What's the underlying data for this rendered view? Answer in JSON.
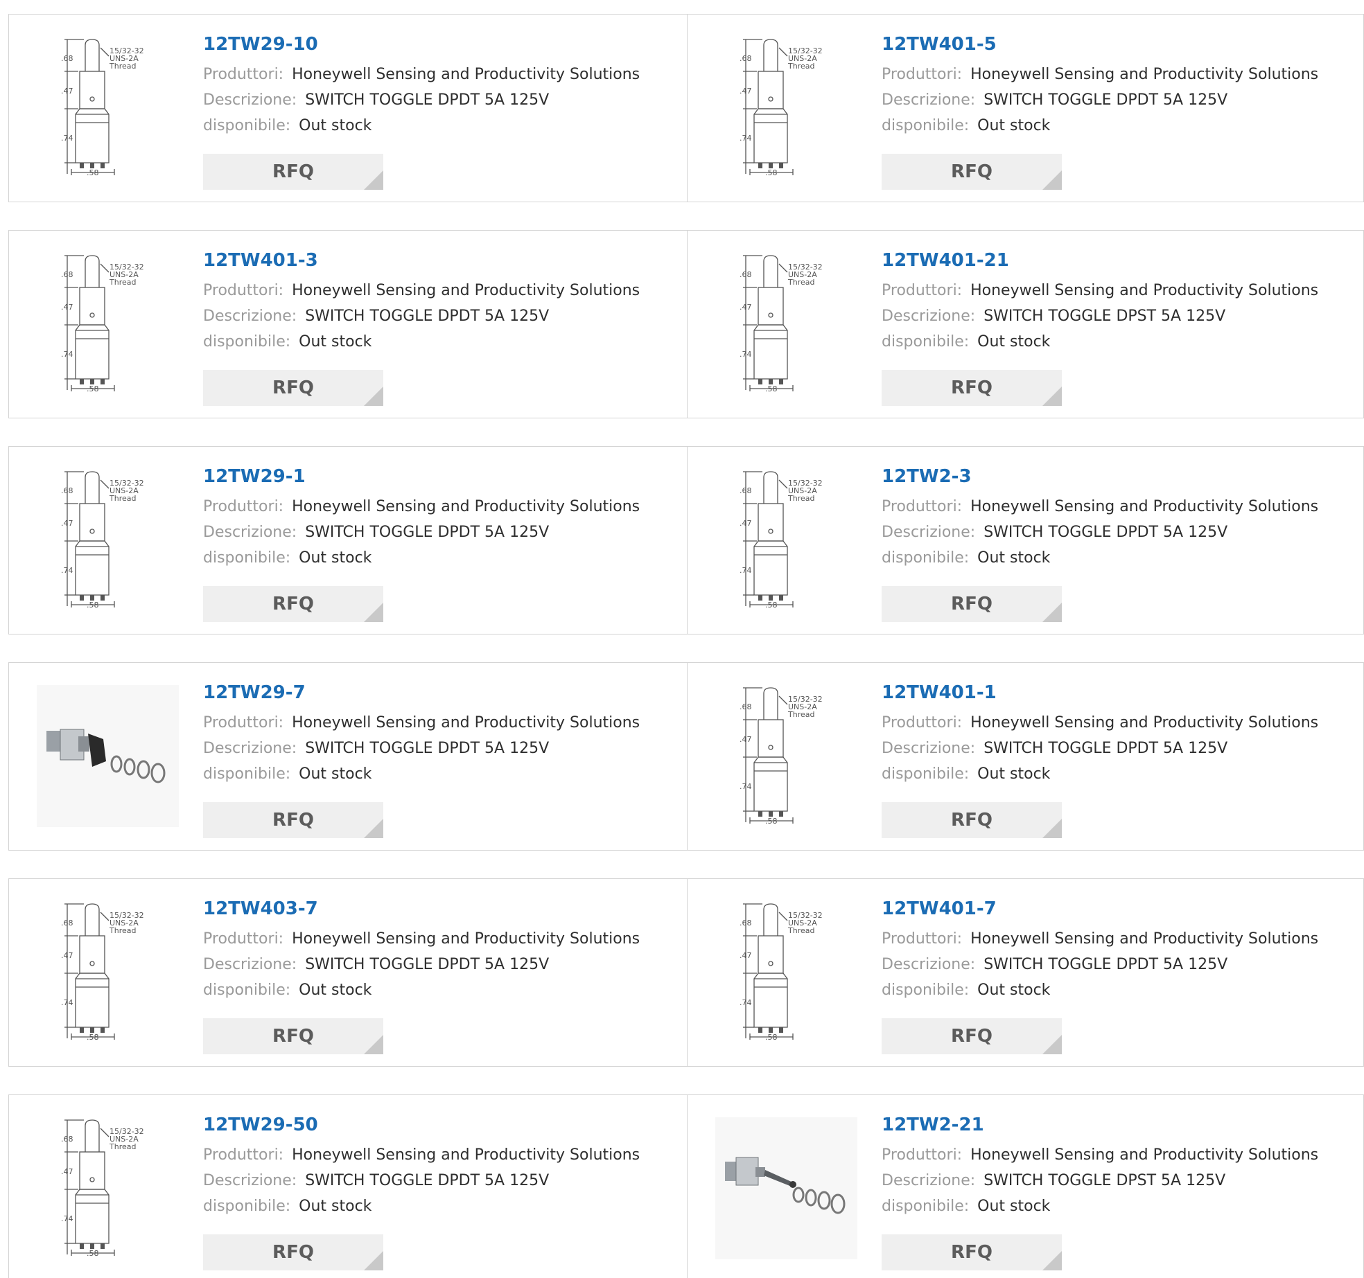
{
  "labels": {
    "manufacturer": "Produttori:",
    "description": "Descrizione:",
    "availability": "disponibile:",
    "rfq": "RFQ"
  },
  "drawing_text": {
    "d1": ".68",
    "d2": ".47",
    "d3": ".74",
    "width": ".58",
    "thread1": "15/32-32",
    "thread2": "UNS-2A",
    "thread3": "Thread"
  },
  "products": [
    {
      "part": "12TW29-10",
      "manufacturer": "Honeywell Sensing and Productivity Solutions",
      "description": "SWITCH TOGGLE DPDT 5A 125V",
      "availability": "Out stock",
      "image": "dimension-drawing"
    },
    {
      "part": "12TW401-5",
      "manufacturer": "Honeywell Sensing and Productivity Solutions",
      "description": "SWITCH TOGGLE DPDT 5A 125V",
      "availability": "Out stock",
      "image": "dimension-drawing"
    },
    {
      "part": "12TW401-3",
      "manufacturer": "Honeywell Sensing and Productivity Solutions",
      "description": "SWITCH TOGGLE DPDT 5A 125V",
      "availability": "Out stock",
      "image": "dimension-drawing"
    },
    {
      "part": "12TW401-21",
      "manufacturer": "Honeywell Sensing and Productivity Solutions",
      "description": "SWITCH TOGGLE DPST 5A 125V",
      "availability": "Out stock",
      "image": "dimension-drawing"
    },
    {
      "part": "12TW29-1",
      "manufacturer": "Honeywell Sensing and Productivity Solutions",
      "description": "SWITCH TOGGLE DPDT 5A 125V",
      "availability": "Out stock",
      "image": "dimension-drawing"
    },
    {
      "part": "12TW2-3",
      "manufacturer": "Honeywell Sensing and Productivity Solutions",
      "description": "SWITCH TOGGLE DPDT 5A 125V",
      "availability": "Out stock",
      "image": "dimension-drawing"
    },
    {
      "part": "12TW29-7",
      "manufacturer": "Honeywell Sensing and Productivity Solutions",
      "description": "SWITCH TOGGLE DPDT 5A 125V",
      "availability": "Out stock",
      "image": "product-photo-paddle"
    },
    {
      "part": "12TW401-1",
      "manufacturer": "Honeywell Sensing and Productivity Solutions",
      "description": "SWITCH TOGGLE DPDT 5A 125V",
      "availability": "Out stock",
      "image": "dimension-drawing"
    },
    {
      "part": "12TW403-7",
      "manufacturer": "Honeywell Sensing and Productivity Solutions",
      "description": "SWITCH TOGGLE DPDT 5A 125V",
      "availability": "Out stock",
      "image": "dimension-drawing"
    },
    {
      "part": "12TW401-7",
      "manufacturer": "Honeywell Sensing and Productivity Solutions",
      "description": "SWITCH TOGGLE DPDT 5A 125V",
      "availability": "Out stock",
      "image": "dimension-drawing"
    },
    {
      "part": "12TW29-50",
      "manufacturer": "Honeywell Sensing and Productivity Solutions",
      "description": "SWITCH TOGGLE DPDT 5A 125V",
      "availability": "Out stock",
      "image": "dimension-drawing"
    },
    {
      "part": "12TW2-21",
      "manufacturer": "Honeywell Sensing and Productivity Solutions",
      "description": "SWITCH TOGGLE DPST 5A 125V",
      "availability": "Out stock",
      "image": "product-photo-lever"
    }
  ],
  "colors": {
    "part_link": "#1b6cb4",
    "label": "#9a9a9a",
    "value": "#2e2e2e",
    "border": "#d4d4d4",
    "rfq_bg": "#efefef",
    "rfq_text": "#5c5c5c"
  }
}
